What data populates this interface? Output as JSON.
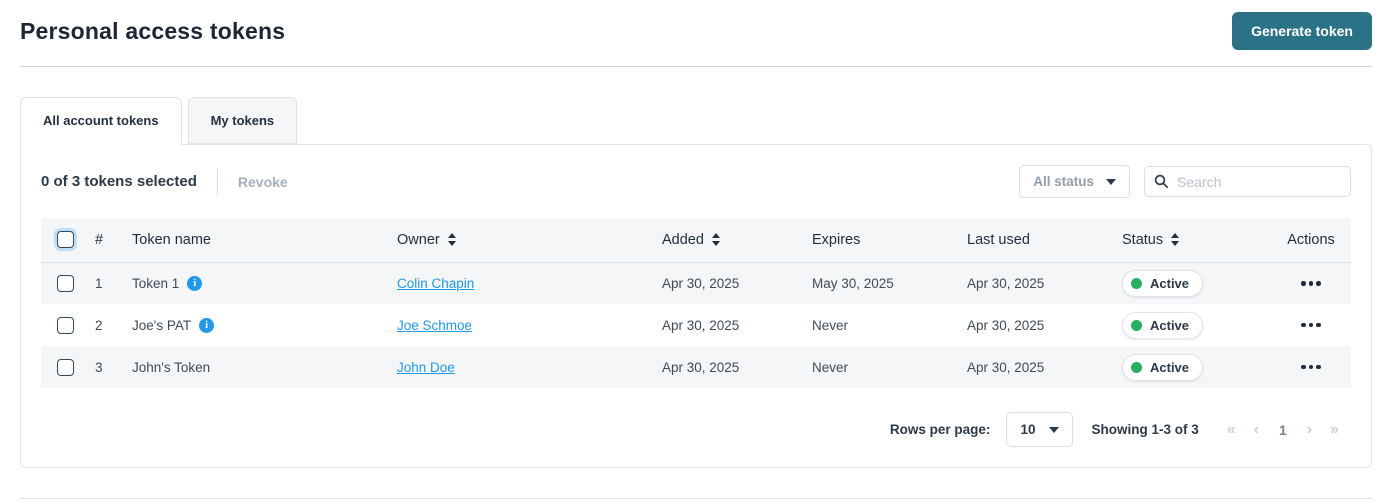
{
  "page": {
    "title": "Personal access tokens"
  },
  "header": {
    "generate_button": "Generate token"
  },
  "tabs": [
    {
      "label": "All account tokens",
      "active": true
    },
    {
      "label": "My tokens",
      "active": false
    }
  ],
  "toolbar": {
    "selection_text": "0 of 3 tokens selected",
    "revoke_label": "Revoke",
    "status_filter_value": "All status",
    "search_placeholder": "Search",
    "search_value": ""
  },
  "table": {
    "headers": {
      "num": "#",
      "name": "Token name",
      "owner": "Owner",
      "added": "Added",
      "expires": "Expires",
      "last_used": "Last used",
      "status": "Status",
      "actions": "Actions"
    },
    "sortable_columns": [
      "Owner",
      "Added",
      "Status"
    ],
    "rows": [
      {
        "num": "1",
        "name": "Token 1",
        "has_info": true,
        "owner": "Colin Chapin",
        "added": "Apr 30, 2025",
        "expires": "May 30, 2025",
        "last_used": "Apr 30, 2025",
        "status": "Active"
      },
      {
        "num": "2",
        "name": "Joe's PAT",
        "has_info": true,
        "owner": "Joe Schmoe",
        "added": "Apr 30, 2025",
        "expires": "Never",
        "last_used": "Apr 30, 2025",
        "status": "Active"
      },
      {
        "num": "3",
        "name": "John's Token",
        "has_info": false,
        "owner": "John Doe",
        "added": "Apr 30, 2025",
        "expires": "Never",
        "last_used": "Apr 30, 2025",
        "status": "Active"
      }
    ]
  },
  "pagination": {
    "rows_per_page_label": "Rows per page:",
    "rows_per_page_value": "10",
    "showing_text": "Showing 1-3 of 3",
    "first": "«",
    "prev": "‹",
    "current_page": "1",
    "next": "›",
    "last": "»"
  },
  "icons": {
    "info": "info-icon",
    "search": "search-icon",
    "sort": "sort-arrows-icon",
    "dropdown": "chevron-down-icon",
    "actions": "ellipsis-icon"
  },
  "colors": {
    "primary_button": "#2b7287",
    "link_blue": "#2199e8",
    "status_green": "#27ae60",
    "row_alt_bg": "#f5f6f7",
    "border": "#dfe3e8",
    "title_text": "#1c2733",
    "muted_text": "#a6b0ba"
  }
}
